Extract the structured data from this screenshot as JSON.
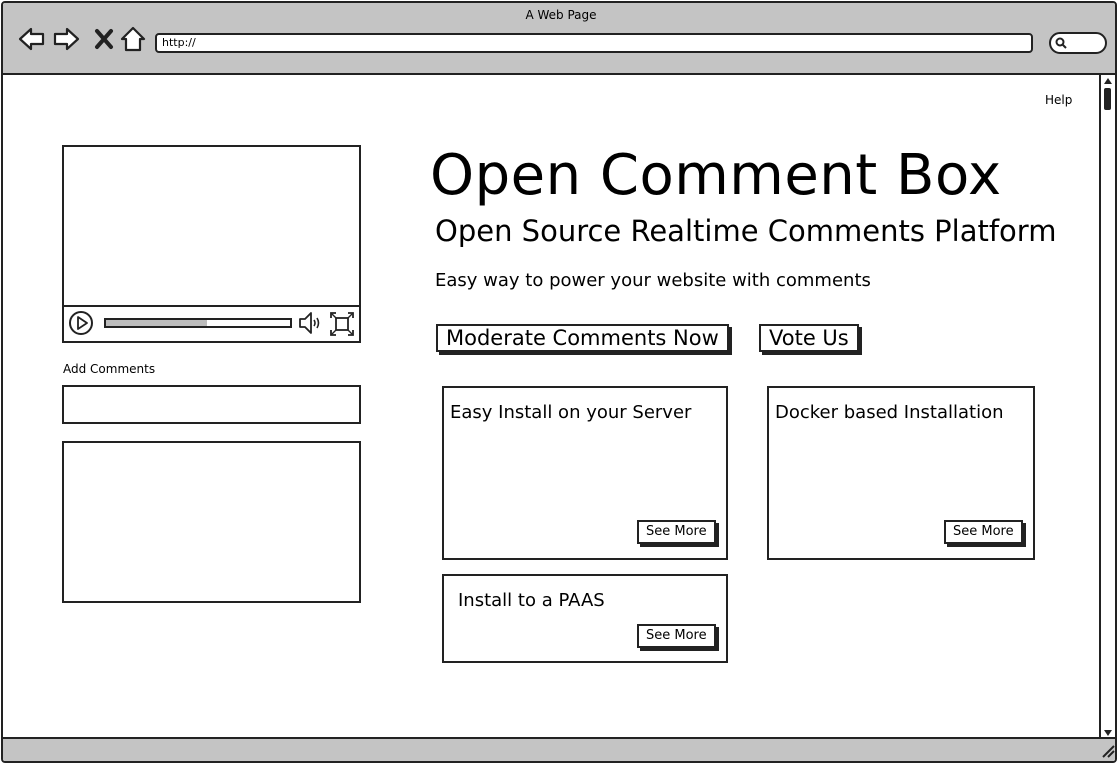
{
  "window": {
    "title": "A Web Page",
    "url": "http://"
  },
  "page": {
    "help_link": "Help",
    "heading": "Open Comment Box",
    "subheading": "Open Source Realtime Comments Platform",
    "tagline": "Easy way to power your website with comments",
    "primary_button": "Moderate Comments Now",
    "secondary_button": "Vote Us"
  },
  "video": {
    "progress": 0.55
  },
  "comments": {
    "label": "Add Comments"
  },
  "cards": [
    {
      "title": "Easy Install on your Server",
      "button": "See More"
    },
    {
      "title": "Docker based Installation",
      "button": "See More"
    },
    {
      "title": "Install to a PAAS",
      "button": "See More"
    }
  ]
}
